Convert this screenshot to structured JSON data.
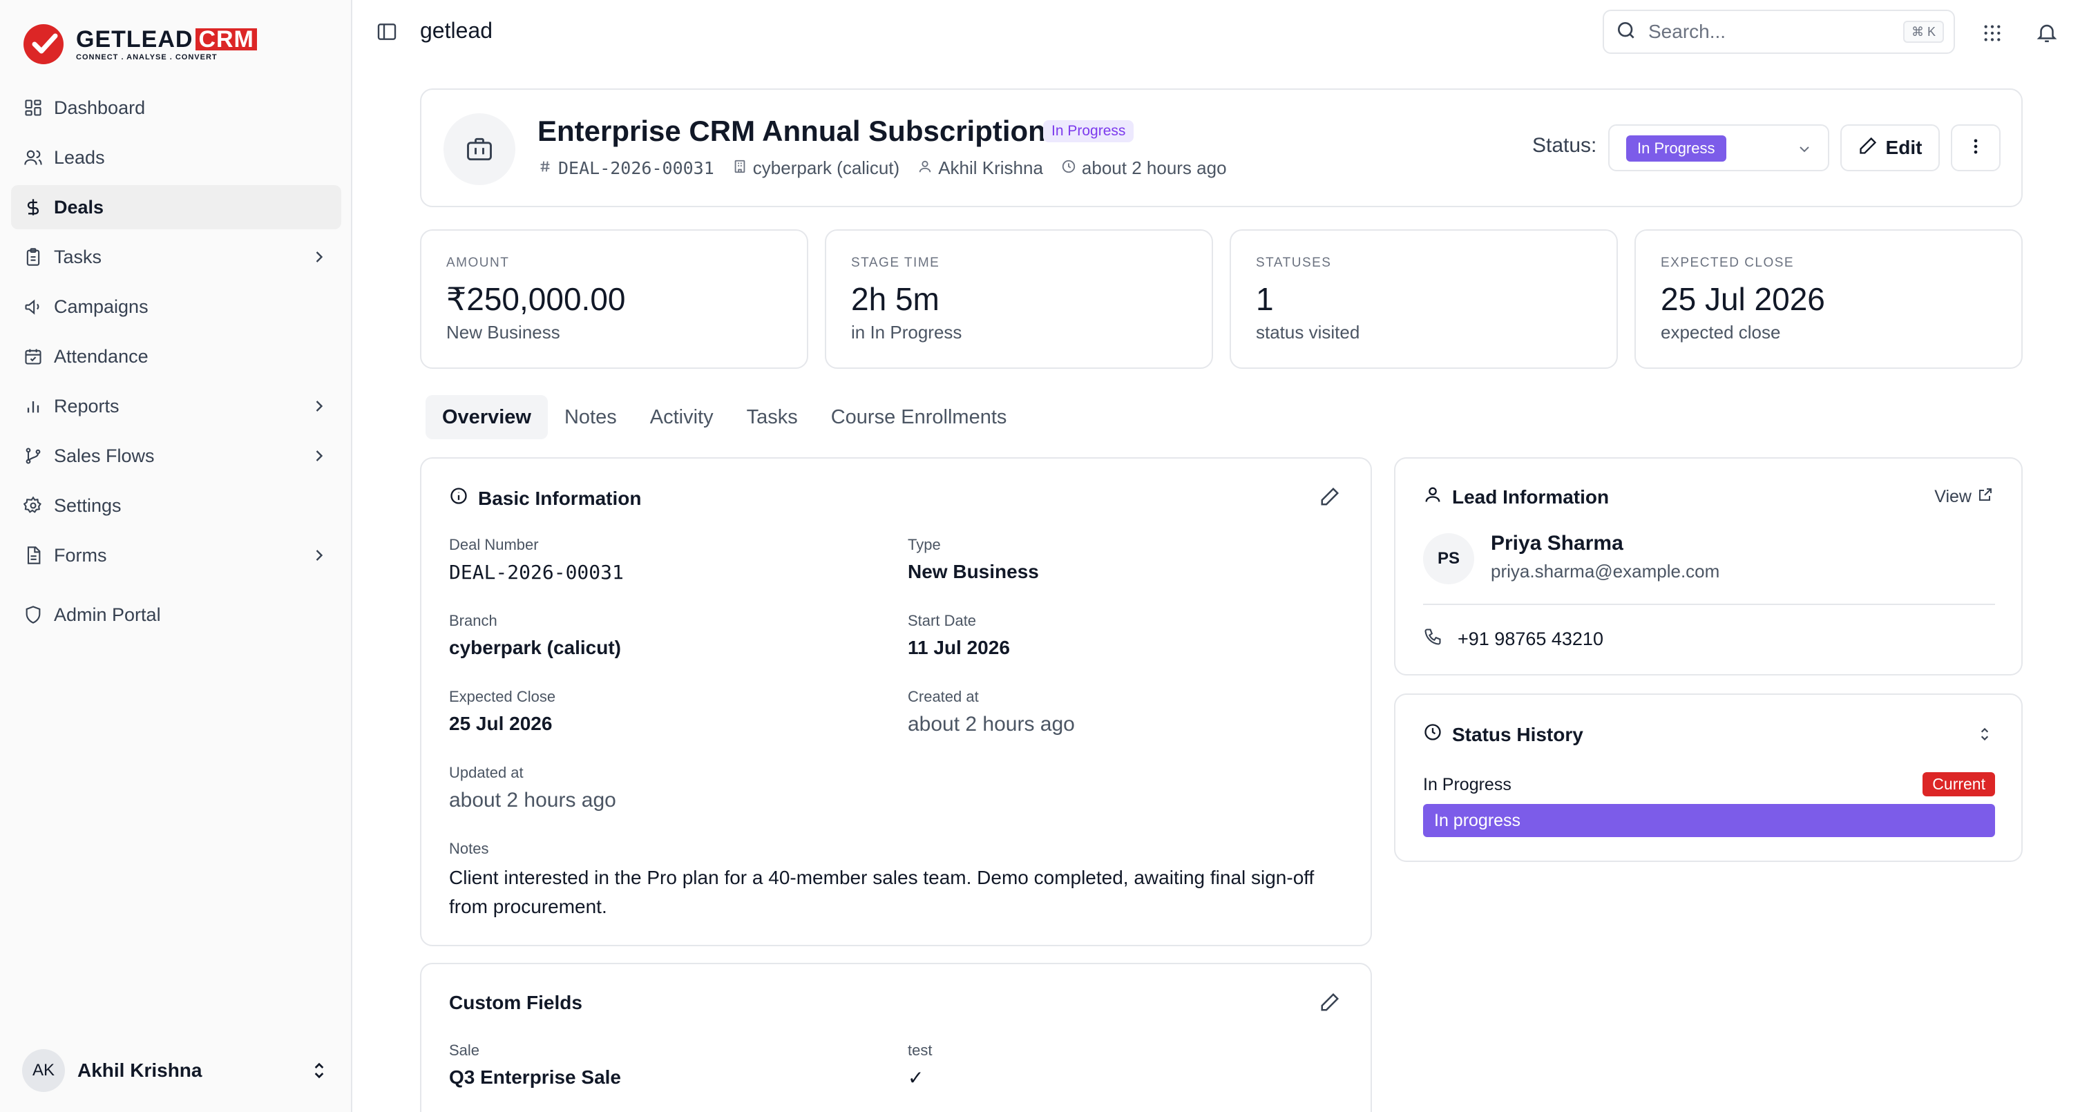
{
  "brand": {
    "name": "GETLEAD",
    "crm": "CRM",
    "tagline": "CONNECT . ANALYSE . CONVERT",
    "accent": "#dc2626",
    "purple": "#7c5ce9"
  },
  "sidebar": {
    "items": [
      {
        "label": "Dashboard",
        "icon": "dashboard-icon"
      },
      {
        "label": "Leads",
        "icon": "users-icon"
      },
      {
        "label": "Deals",
        "icon": "dollar-icon"
      },
      {
        "label": "Tasks",
        "icon": "clipboard-icon"
      },
      {
        "label": "Campaigns",
        "icon": "megaphone-icon"
      },
      {
        "label": "Attendance",
        "icon": "calendar-check-icon"
      },
      {
        "label": "Reports",
        "icon": "bar-chart-icon"
      },
      {
        "label": "Sales Flows",
        "icon": "git-branch-icon"
      },
      {
        "label": "Settings",
        "icon": "gear-icon"
      },
      {
        "label": "Forms",
        "icon": "file-text-icon"
      },
      {
        "label": "Admin Portal",
        "icon": "shield-icon"
      }
    ],
    "user": {
      "initials": "AK",
      "name": "Akhil Krishna"
    }
  },
  "topbar": {
    "title": "getlead",
    "search_placeholder": "Search...",
    "shortcut": "⌘ K"
  },
  "deal": {
    "title": "Enterprise CRM Annual Subscription",
    "badge": "In Progress",
    "number": "DEAL-2026-00031",
    "branch": "cyberpark (calicut)",
    "owner": "Akhil Krishna",
    "created": "about 2 hours ago",
    "status_label": "Status:",
    "status_value": "In Progress",
    "edit_label": "Edit"
  },
  "stats": [
    {
      "label": "AMOUNT",
      "value": "₹250,000.00",
      "sub": "New Business"
    },
    {
      "label": "STAGE TIME",
      "value": "2h 5m",
      "sub": "in In Progress"
    },
    {
      "label": "STATUSES",
      "value": "1",
      "sub": "status visited"
    },
    {
      "label": "EXPECTED CLOSE",
      "value": "25 Jul 2026",
      "sub": "expected close"
    }
  ],
  "tabs": [
    "Overview",
    "Notes",
    "Activity",
    "Tasks",
    "Course Enrollments"
  ],
  "basic": {
    "title": "Basic Information",
    "deal_number_label": "Deal Number",
    "deal_number": "DEAL-2026-00031",
    "type_label": "Type",
    "type": "New Business",
    "branch_label": "Branch",
    "branch": "cyberpark (calicut)",
    "start_label": "Start Date",
    "start": "11 Jul 2026",
    "close_label": "Expected Close",
    "close": "25 Jul 2026",
    "created_label": "Created at",
    "created": "about 2 hours ago",
    "updated_label": "Updated at",
    "updated": "about 2 hours ago",
    "notes_label": "Notes",
    "notes": "Client interested in the Pro plan for a 40-member sales team. Demo completed, awaiting final sign-off from procurement."
  },
  "custom": {
    "title": "Custom Fields",
    "sale_label": "Sale",
    "sale": "Q3 Enterprise Sale",
    "test_label": "test",
    "test": "✓"
  },
  "lead": {
    "title": "Lead Information",
    "view": "View",
    "initials": "PS",
    "name": "Priya Sharma",
    "email": "priya.sharma@example.com",
    "phone": "+91 98765 43210"
  },
  "history": {
    "title": "Status History",
    "status": "In Progress",
    "current": "Current",
    "bar": "In progress"
  }
}
